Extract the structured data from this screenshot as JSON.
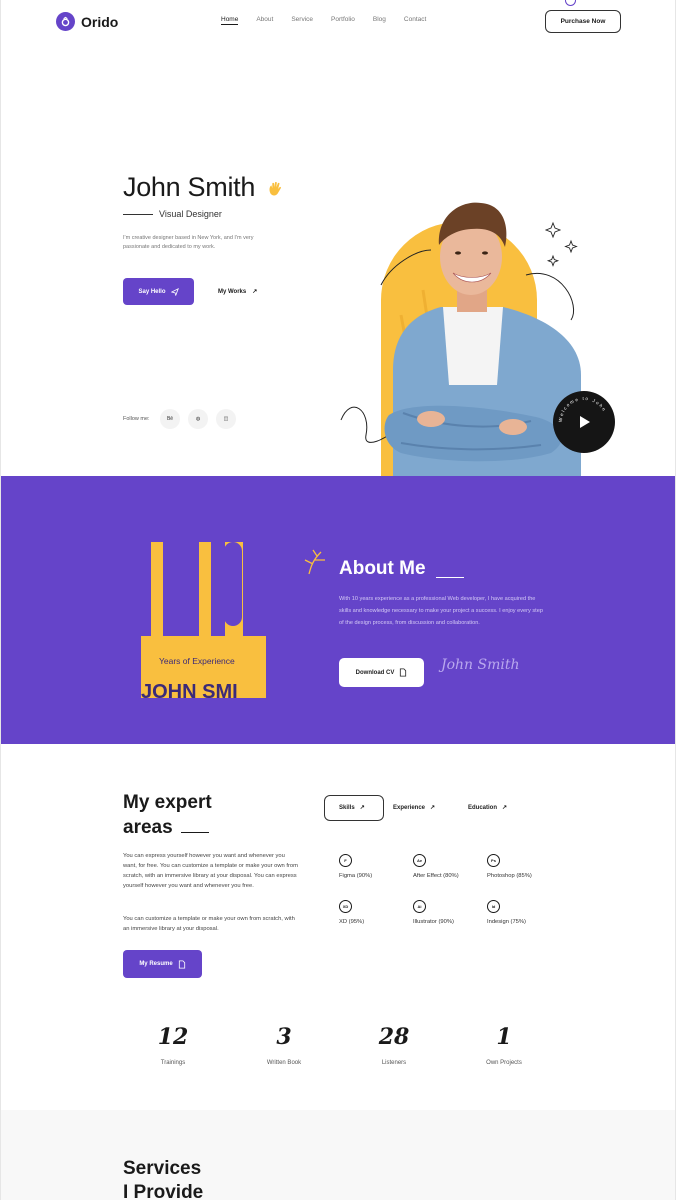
{
  "brand": {
    "name": "Orido",
    "accent": "#6544c9",
    "highlight": "#f9bf3f"
  },
  "nav": {
    "items": [
      "Home",
      "About",
      "Service",
      "Portfolio",
      "Blog",
      "Contact"
    ],
    "active": "Home",
    "cta": "Purchase Now"
  },
  "hero": {
    "name": "John Smith",
    "role": "Visual Designer",
    "description": "I'm creative designer based in New York, and I'm very passionate and dedicated to my work.",
    "primary_button": "Say Hello",
    "secondary_link": "My Works",
    "follow_label": "Follow me:",
    "socials": [
      "be-icon",
      "dribbble-icon",
      "instagram-icon"
    ],
    "badge_text": "Welcome to John"
  },
  "about": {
    "years_number": "10",
    "years_label": "Years of Experience",
    "ribbon_name": "JOHN SMI",
    "title": "About Me",
    "description": "With 10 years experience as a professional Web developer, I have acquired the skills and knowledge necessary to make your project a success. I enjoy every step of the design process, from discussion and collaboration.",
    "button": "Download CV",
    "signature": "John Smith"
  },
  "expert": {
    "title_line1": "My expert",
    "title_line2": "areas",
    "para1": "You can express yourself however you want and whenever you want, for free. You can customize a template or make your own from scratch, with an immersive library at your disposal. You can express yourself however you want and whenever you free.",
    "para2": "You can customize a template or make your own from scratch, with an immersive library at your disposal.",
    "button": "My Resume",
    "tabs": [
      "Skills",
      "Experience",
      "Education"
    ],
    "active_tab": "Skills",
    "skills": [
      {
        "icon": "F",
        "label": "Figma (90%)"
      },
      {
        "icon": "Ae",
        "label": "After Effect (80%)"
      },
      {
        "icon": "Ps",
        "label": "Photoshop (85%)"
      },
      {
        "icon": "XD",
        "label": "XD (95%)"
      },
      {
        "icon": "Ai",
        "label": "Illustrator (90%)"
      },
      {
        "icon": "Id",
        "label": "Indesign (75%)"
      }
    ]
  },
  "stats": [
    {
      "value": "12",
      "label": "Trainings"
    },
    {
      "value": "3",
      "label": "Written Book"
    },
    {
      "value": "28",
      "label": "Listeners"
    },
    {
      "value": "1",
      "label": "Own Projects"
    }
  ],
  "services": {
    "title_line1": "Services",
    "title_line2": "I Provide"
  }
}
